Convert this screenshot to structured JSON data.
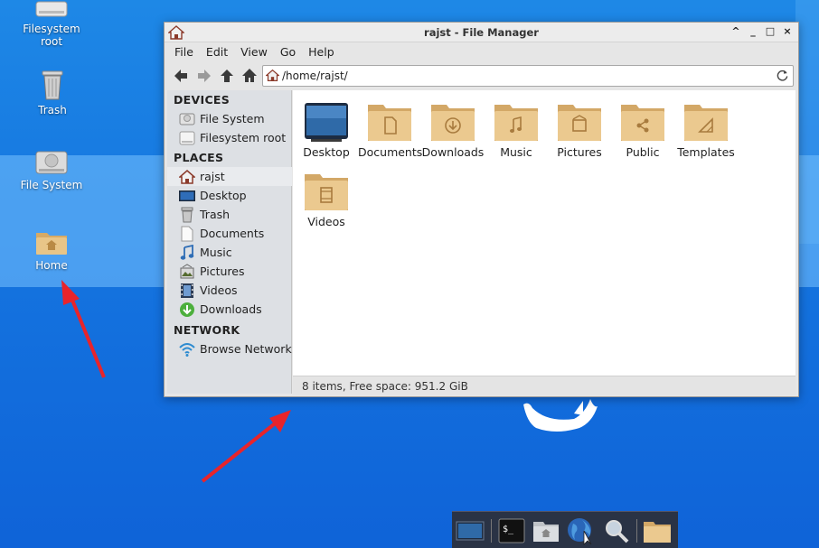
{
  "desktop": {
    "icons": [
      {
        "label_line1": "Filesystem",
        "label_line2": "root",
        "icon": "drive-icon"
      },
      {
        "label_line1": "Trash",
        "label_line2": "",
        "icon": "trash-icon"
      },
      {
        "label_line1": "File System",
        "label_line2": "",
        "icon": "harddisk-icon"
      },
      {
        "label_line1": "Home",
        "label_line2": "",
        "icon": "home-folder-icon"
      }
    ]
  },
  "window": {
    "title": "rajst - File Manager",
    "controls": [
      "^",
      "_",
      "□",
      "×"
    ],
    "menu": [
      "File",
      "Edit",
      "View",
      "Go",
      "Help"
    ],
    "address": "/home/rajst/",
    "sidebar": {
      "devices_header": "DEVICES",
      "devices": [
        "File System",
        "Filesystem root"
      ],
      "places_header": "PLACES",
      "places": [
        "rajst",
        "Desktop",
        "Trash",
        "Documents",
        "Music",
        "Pictures",
        "Videos",
        "Downloads"
      ],
      "network_header": "NETWORK",
      "network": [
        "Browse Network"
      ]
    },
    "files": [
      "Desktop",
      "Documents",
      "Downloads",
      "Music",
      "Pictures",
      "Public",
      "Templates",
      "Videos"
    ],
    "status": "8 items, Free space: 951.2 GiB"
  },
  "colors": {
    "folder": "#e3c08a",
    "annotation_arrow": "#e8242b",
    "desktop_bg": "#1576e0"
  }
}
